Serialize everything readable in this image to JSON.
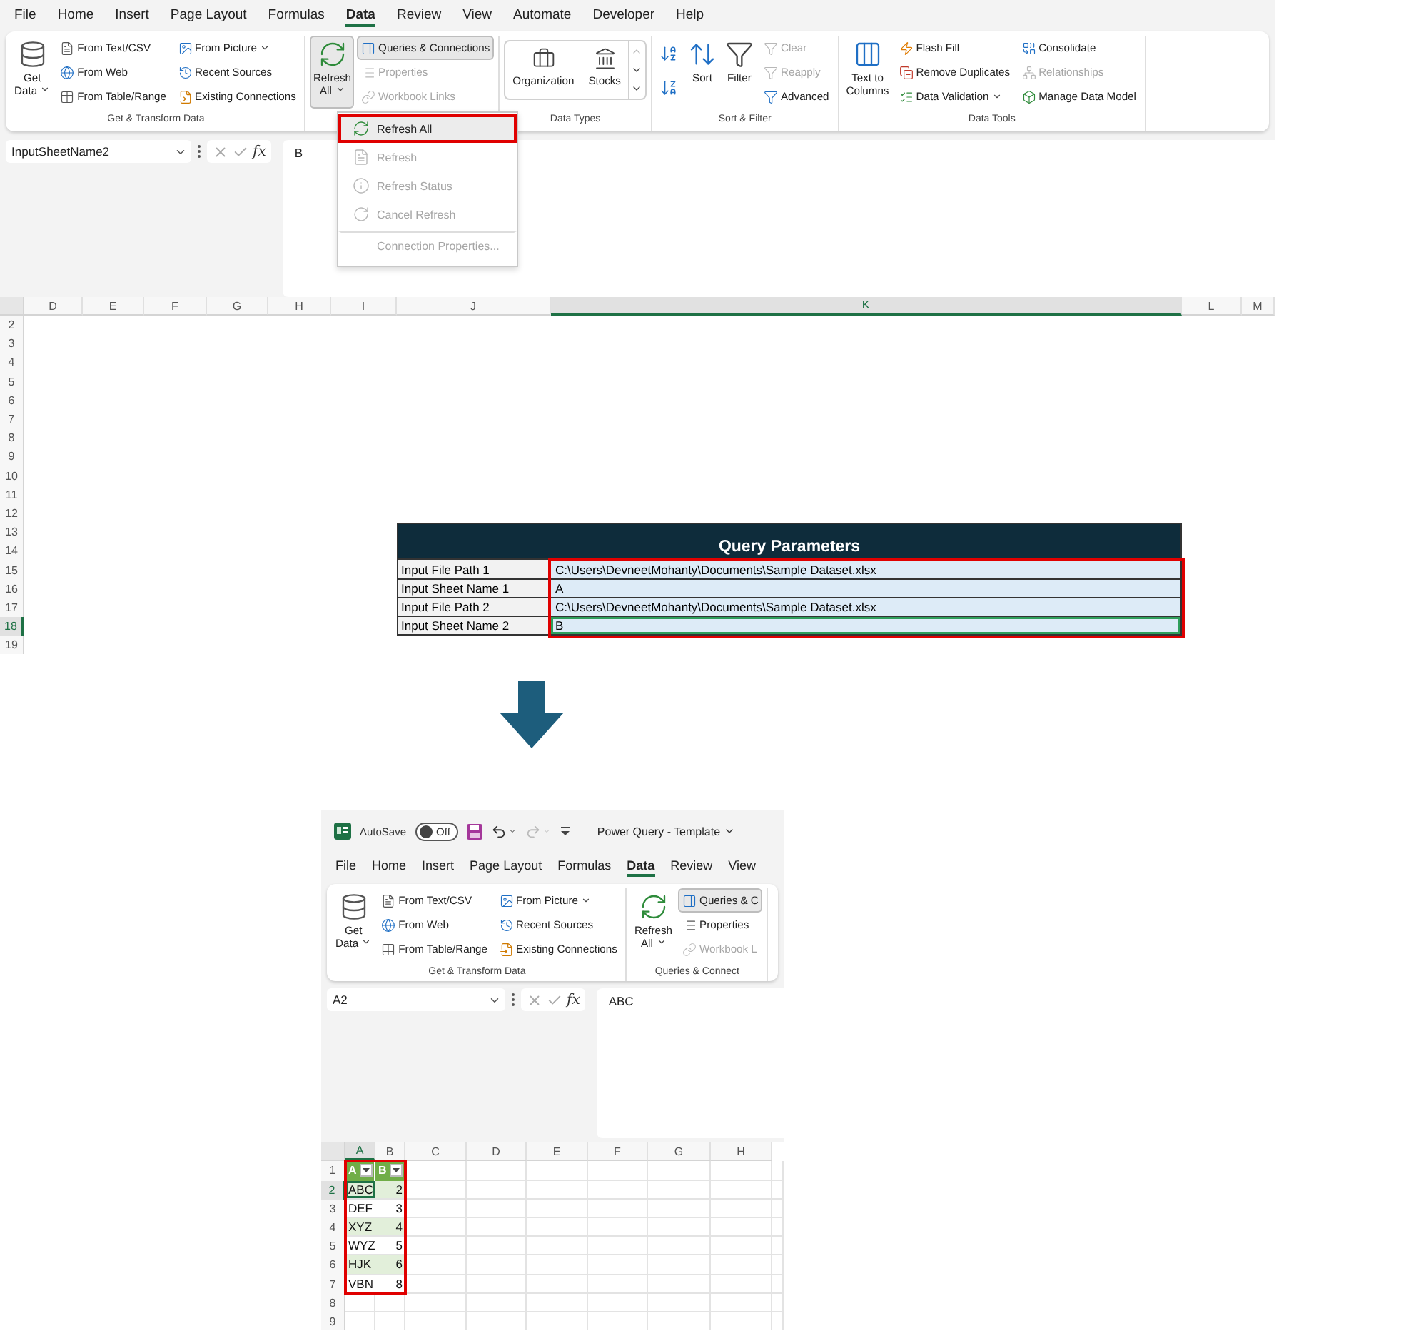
{
  "top_window": {
    "tabs": [
      {
        "label": "File",
        "selected": false
      },
      {
        "label": "Home",
        "selected": false
      },
      {
        "label": "Insert",
        "selected": false
      },
      {
        "label": "Page Layout",
        "selected": false
      },
      {
        "label": "Formulas",
        "selected": false
      },
      {
        "label": "Data",
        "selected": true
      },
      {
        "label": "Review",
        "selected": false
      },
      {
        "label": "View",
        "selected": false
      },
      {
        "label": "Automate",
        "selected": false
      },
      {
        "label": "Developer",
        "selected": false
      },
      {
        "label": "Help",
        "selected": false
      }
    ],
    "ribbon": [
      {
        "label": "Get & Transform Data",
        "items": [
          {
            "kind": "large",
            "label": "Get Data",
            "pressed": false,
            "dropdown": true
          },
          {
            "kind": "column",
            "entries": [
              {
                "label": "From Text/CSV",
                "pressed": false,
                "disabled": false
              },
              {
                "label": "From Web",
                "pressed": false,
                "disabled": false
              },
              {
                "label": "From Table/Range",
                "pressed": false,
                "disabled": false
              }
            ]
          },
          {
            "kind": "column",
            "entries": [
              {
                "label": "From Picture",
                "pressed": false,
                "disabled": false,
                "dropdown": true
              },
              {
                "label": "Recent Sources",
                "pressed": false,
                "disabled": false
              },
              {
                "label": "Existing Connections",
                "pressed": false,
                "disabled": false
              }
            ]
          }
        ]
      },
      {
        "items": [
          {
            "kind": "large",
            "label": "Refresh All",
            "pressed": true,
            "dropdown": true
          },
          {
            "kind": "column",
            "entries": [
              {
                "label": "Queries & Connections",
                "pressed": true,
                "disabled": false
              },
              {
                "label": "Properties",
                "pressed": false,
                "disabled": true
              },
              {
                "label": "Workbook Links",
                "pressed": false,
                "disabled": true
              }
            ]
          }
        ]
      },
      {
        "label": "Data Types",
        "items": [
          {
            "kind": "gallery",
            "entries": [
              {
                "label": "Organization"
              },
              {
                "label": "Stocks"
              }
            ]
          }
        ]
      },
      {
        "label": "Sort & Filter",
        "items": [
          {
            "kind": "sort_pair"
          },
          {
            "kind": "large",
            "label": "Sort",
            "pressed": false
          },
          {
            "kind": "large",
            "label": "Filter",
            "pressed": false
          },
          {
            "kind": "column",
            "entries": [
              {
                "label": "Clear",
                "pressed": false,
                "disabled": true
              },
              {
                "label": "Reapply",
                "pressed": false,
                "disabled": true
              },
              {
                "label": "Advanced",
                "pressed": false,
                "disabled": false
              }
            ]
          }
        ]
      },
      {
        "label": "Data Tools",
        "items": [
          {
            "kind": "large",
            "label": "Text to Columns",
            "pressed": false
          },
          {
            "kind": "column",
            "entries": [
              {
                "label": "Flash Fill",
                "pressed": false,
                "disabled": false
              },
              {
                "label": "Remove Duplicates",
                "pressed": false,
                "disabled": false
              },
              {
                "label": "Data Validation",
                "pressed": false,
                "disabled": false,
                "dropdown": true
              }
            ]
          },
          {
            "kind": "column",
            "entries": [
              {
                "label": "Consolidate",
                "pressed": false,
                "disabled": false
              },
              {
                "label": "Relationships",
                "pressed": false,
                "disabled": true
              },
              {
                "label": "Manage Data Model",
                "pressed": false,
                "disabled": false
              }
            ]
          }
        ]
      }
    ],
    "refresh_menu": [
      {
        "label": "Refresh All",
        "highlighted": true,
        "disabled": false,
        "divider_above": false
      },
      {
        "label": "Refresh",
        "highlighted": false,
        "disabled": true,
        "divider_above": false
      },
      {
        "label": "Refresh Status",
        "highlighted": false,
        "disabled": true,
        "divider_above": false
      },
      {
        "label": "Cancel Refresh",
        "highlighted": false,
        "disabled": true,
        "divider_above": false
      },
      {
        "label": "Connection Properties...",
        "highlighted": false,
        "disabled": true,
        "divider_above": true
      }
    ],
    "formula_bar": {
      "name_box": "InputSheetName2",
      "function_label": "fx",
      "formula": "B"
    },
    "sheet": {
      "columns": [
        {
          "label": "D",
          "selected": false
        },
        {
          "label": "E",
          "selected": false
        },
        {
          "label": "F",
          "selected": false
        },
        {
          "label": "G",
          "selected": false
        },
        {
          "label": "H",
          "selected": false
        },
        {
          "label": "I",
          "selected": false
        },
        {
          "label": "J",
          "selected": false
        },
        {
          "label": "K",
          "selected": true
        },
        {
          "label": "L",
          "selected": false
        },
        {
          "label": "M",
          "selected": false
        }
      ],
      "rows": [
        {
          "number": "2",
          "selected": false
        },
        {
          "number": "3",
          "selected": false
        },
        {
          "number": "4",
          "selected": false
        },
        {
          "number": "5",
          "selected": false
        },
        {
          "number": "6",
          "selected": false
        },
        {
          "number": "7",
          "selected": false
        },
        {
          "number": "8",
          "selected": false
        },
        {
          "number": "9",
          "selected": false
        },
        {
          "number": "10",
          "selected": false
        },
        {
          "number": "11",
          "selected": false
        },
        {
          "number": "12",
          "selected": false
        },
        {
          "number": "13",
          "selected": false
        },
        {
          "number": "14",
          "selected": false
        },
        {
          "number": "15",
          "selected": false
        },
        {
          "number": "16",
          "selected": false
        },
        {
          "number": "17",
          "selected": false
        },
        {
          "number": "18",
          "selected": true
        },
        {
          "number": "19",
          "selected": false
        }
      ],
      "table": {
        "title": "Query Parameters",
        "rows": [
          {
            "label": "Input File Path 1",
            "value": "C:\\Users\\DevneetMohanty\\Documents\\Sample Dataset.xlsx",
            "selected": false
          },
          {
            "label": "Input Sheet Name 1",
            "value": "A",
            "selected": false
          },
          {
            "label": "Input File Path 2",
            "value": "C:\\Users\\DevneetMohanty\\Documents\\Sample Dataset.xlsx",
            "selected": false
          },
          {
            "label": "Input Sheet Name 2",
            "value": "B",
            "selected": true
          }
        ]
      }
    }
  },
  "bottom_window": {
    "title_bar": {
      "autosave": {
        "label": "AutoSave",
        "state_label": "Off",
        "on": false
      },
      "document_title": "Power Query - Template"
    },
    "tabs": [
      {
        "label": "File",
        "selected": false
      },
      {
        "label": "Home",
        "selected": false
      },
      {
        "label": "Insert",
        "selected": false
      },
      {
        "label": "Page Layout",
        "selected": false
      },
      {
        "label": "Formulas",
        "selected": false
      },
      {
        "label": "Data",
        "selected": true
      },
      {
        "label": "Review",
        "selected": false
      },
      {
        "label": "View",
        "selected": false
      }
    ],
    "ribbon": [
      {
        "label": "Get & Transform Data",
        "items": [
          {
            "kind": "large",
            "label": "Get Data",
            "pressed": false,
            "dropdown": true
          },
          {
            "kind": "column",
            "entries": [
              {
                "label": "From Text/CSV",
                "pressed": false,
                "disabled": false
              },
              {
                "label": "From Web",
                "pressed": false,
                "disabled": false
              },
              {
                "label": "From Table/Range",
                "pressed": false,
                "disabled": false
              }
            ]
          },
          {
            "kind": "column",
            "entries": [
              {
                "label": "From Picture",
                "pressed": false,
                "disabled": false,
                "dropdown": true
              },
              {
                "label": "Recent Sources",
                "pressed": false,
                "disabled": false
              },
              {
                "label": "Existing Connections",
                "pressed": false,
                "disabled": false
              }
            ]
          }
        ]
      },
      {
        "label": "Queries & Connect",
        "items": [
          {
            "kind": "large",
            "label": "Refresh All",
            "pressed": false,
            "dropdown": true
          },
          {
            "kind": "column",
            "entries": [
              {
                "label": "Queries & C",
                "pressed": true,
                "disabled": false
              },
              {
                "label": "Properties",
                "pressed": false,
                "disabled": false
              },
              {
                "label": "Workbook L",
                "pressed": false,
                "disabled": true
              }
            ]
          }
        ]
      }
    ],
    "formula_bar": {
      "name_box": "A2",
      "function_label": "fx",
      "formula": "ABC"
    },
    "sheet": {
      "columns": [
        {
          "label": "A",
          "selected": true
        },
        {
          "label": "B",
          "selected": false
        },
        {
          "label": "C",
          "selected": false
        },
        {
          "label": "D",
          "selected": false
        },
        {
          "label": "E",
          "selected": false
        },
        {
          "label": "F",
          "selected": false
        },
        {
          "label": "G",
          "selected": false
        },
        {
          "label": "H",
          "selected": false
        }
      ],
      "rows": [
        {
          "number": "1",
          "selected": false
        },
        {
          "number": "2",
          "selected": true
        },
        {
          "number": "3",
          "selected": false
        },
        {
          "number": "4",
          "selected": false
        },
        {
          "number": "5",
          "selected": false
        },
        {
          "number": "6",
          "selected": false
        },
        {
          "number": "7",
          "selected": false
        },
        {
          "number": "8",
          "selected": false
        },
        {
          "number": "9",
          "selected": false
        }
      ],
      "table": {
        "headers": [
          "A",
          "B"
        ],
        "rows": [
          {
            "cells": [
              "ABC",
              "2"
            ],
            "selected": true
          },
          {
            "cells": [
              "DEF",
              "3"
            ],
            "selected": false
          },
          {
            "cells": [
              "XYZ",
              "4"
            ],
            "selected": false
          },
          {
            "cells": [
              "WYZ",
              "5"
            ],
            "selected": false
          },
          {
            "cells": [
              "HJK",
              "6"
            ],
            "selected": false
          },
          {
            "cells": [
              "VBN",
              "8"
            ],
            "selected": false
          }
        ]
      }
    }
  }
}
